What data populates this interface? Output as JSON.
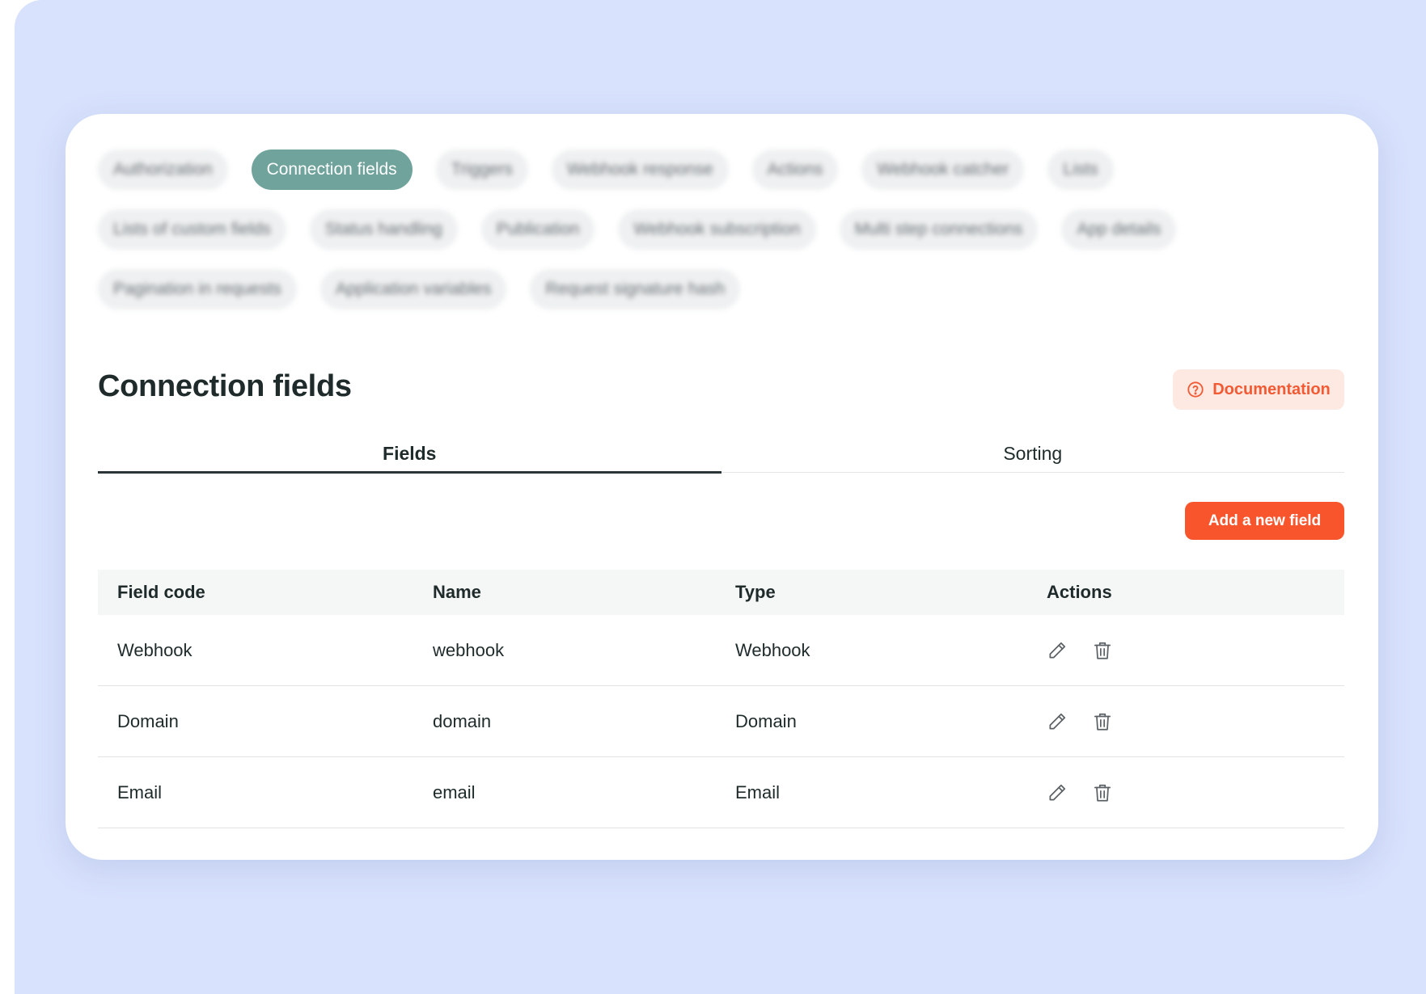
{
  "colors": {
    "background": "#d8e2fd",
    "accent": "#f8552d",
    "active_pill": "#6fa39c",
    "doc_button_bg": "#fde8e2"
  },
  "pills": {
    "row1": [
      "Authorization",
      "Connection fields",
      "Triggers",
      "Webhook response",
      "Actions",
      "Webhook catcher",
      "Lists"
    ],
    "row2": [
      "Lists of custom fields",
      "Status handling",
      "Publication",
      "Webhook subscription",
      "Multi step connections",
      "App details"
    ],
    "row3": [
      "Pagination in requests",
      "Application variables",
      "Request signature hash"
    ],
    "active": "Connection fields"
  },
  "page": {
    "title": "Connection fields",
    "documentation_label": "Documentation",
    "documentation_icon": "question-circle-icon"
  },
  "tabs": {
    "fields": "Fields",
    "sorting": "Sorting",
    "active": "Fields"
  },
  "add_button_label": "Add a new field",
  "table": {
    "headers": [
      "Field code",
      "Name",
      "Type",
      "Actions"
    ],
    "rows": [
      {
        "field_code": "Webhook",
        "name": "webhook",
        "type": "Webhook"
      },
      {
        "field_code": "Domain",
        "name": "domain",
        "type": "Domain"
      },
      {
        "field_code": "Email",
        "name": "email",
        "type": "Email"
      }
    ],
    "action_icons": [
      "pencil-icon",
      "trash-icon"
    ]
  }
}
